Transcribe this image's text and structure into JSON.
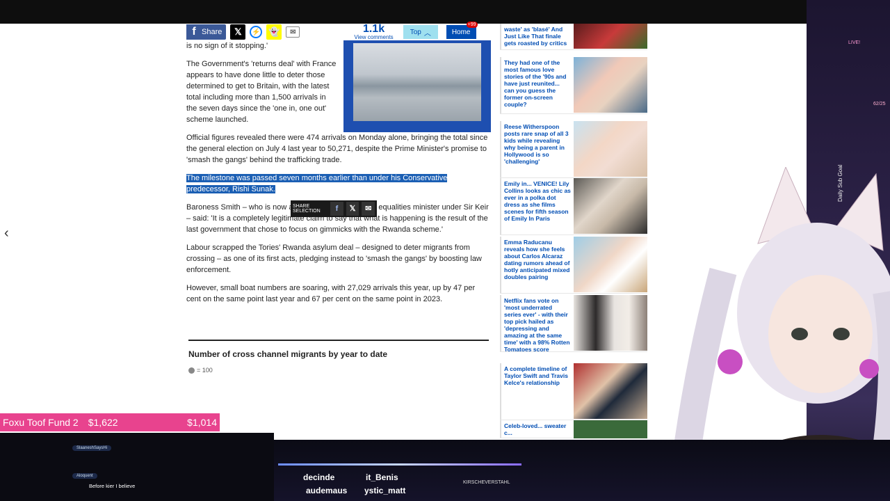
{
  "share_bar": {
    "share_label": "Share",
    "comments_count": "1.1k",
    "comments_label": "View comments",
    "top_label": "Top",
    "home_label": "Home",
    "home_badge": "+99"
  },
  "article": {
    "p0": "is no sign of it stopping.'",
    "p1": "The Government's 'returns deal' with France appears to have done little to deter those determined to get to Britain, with the latest total including more than 1,500 arrivals in the seven days since the 'one in, one out' scheme launched.",
    "p2": "Official figures revealed there were 474 arrivals on Monday alone, bringing the total since the general election on July 4 last year to 50,271, despite the Prime Minister's promise to 'smash the gangs' behind the trafficking trade.",
    "p3": "The milestone was passed seven months earlier than under his Conservative predecessor, Rishi Sunak.",
    "p4": "Baroness Smith – who is now an education, women and equalities minister under Sir Keir – said: 'It is a completely legitimate claim to say that what is happening is the result of the last government that chose to focus on gimmicks with the Rwanda scheme.'",
    "p5": "Labour scrapped the Tories' Rwanda asylum deal – designed to deter migrants from crossing – as one of its first acts, pledging instead to 'smash the gangs' by boosting law enforcement.",
    "p6": "However, small boat numbers are soaring, with 27,029 arrivals this year, up by 47 per cent on the same point last year and 67 per cent on the same point in 2023.",
    "selection_popup": "SHARE SELECTION",
    "chart_title": "Number of cross channel migrants by year to date",
    "chart_legend": "= 100"
  },
  "sidebar": {
    "items": [
      {
        "text": "waste' as 'blasé' And Just Like That finale gets roasted by critics"
      },
      {
        "text": "They had one of the most famous love stories of the '90s and have just reunited... can you guess the former on-screen couple?"
      },
      {
        "text": "Reese Witherspoon posts rare snap of all 3 kids while revealing why being a parent in Hollywood is so 'challenging'"
      },
      {
        "text": "Emily in... VENICE! Lily Collins looks as chic as ever in a polka dot dress as she films scenes for fifth season of Emily In Paris"
      },
      {
        "text": "Emma Raducanu reveals how she feels about Carlos Alcaraz dating rumors ahead of hotly anticipated mixed doubles pairing"
      },
      {
        "text": "Netflix fans vote on 'most underrated series ever' - with their top pick hailed as 'depressing and amazing at the same time' with a 98% Rotten Tomatoes score"
      },
      {
        "text": "A complete timeline of Taylor Swift and Travis Kelce's relationship"
      },
      {
        "text": "Celeb-loved... sweater c..."
      }
    ]
  },
  "stream": {
    "fund_name": "Foxu Toof Fund 2",
    "fund_raised": "$1,622",
    "fund_goal": "$1,014",
    "chat": [
      {
        "user": "SlaaneshSaysHi",
        "message": ""
      },
      {
        "user": "Aloquent",
        "message": "Before kier I believe"
      }
    ],
    "ticker": [
      "decinde",
      "it_Benis",
      "audemaus",
      "ystic_matt"
    ],
    "twitter_handle": "KIRSCHEVERSTAHL",
    "side_goal": "Daily Sub Goal",
    "live_label": "LIVE!",
    "sub_count": "62/25"
  }
}
